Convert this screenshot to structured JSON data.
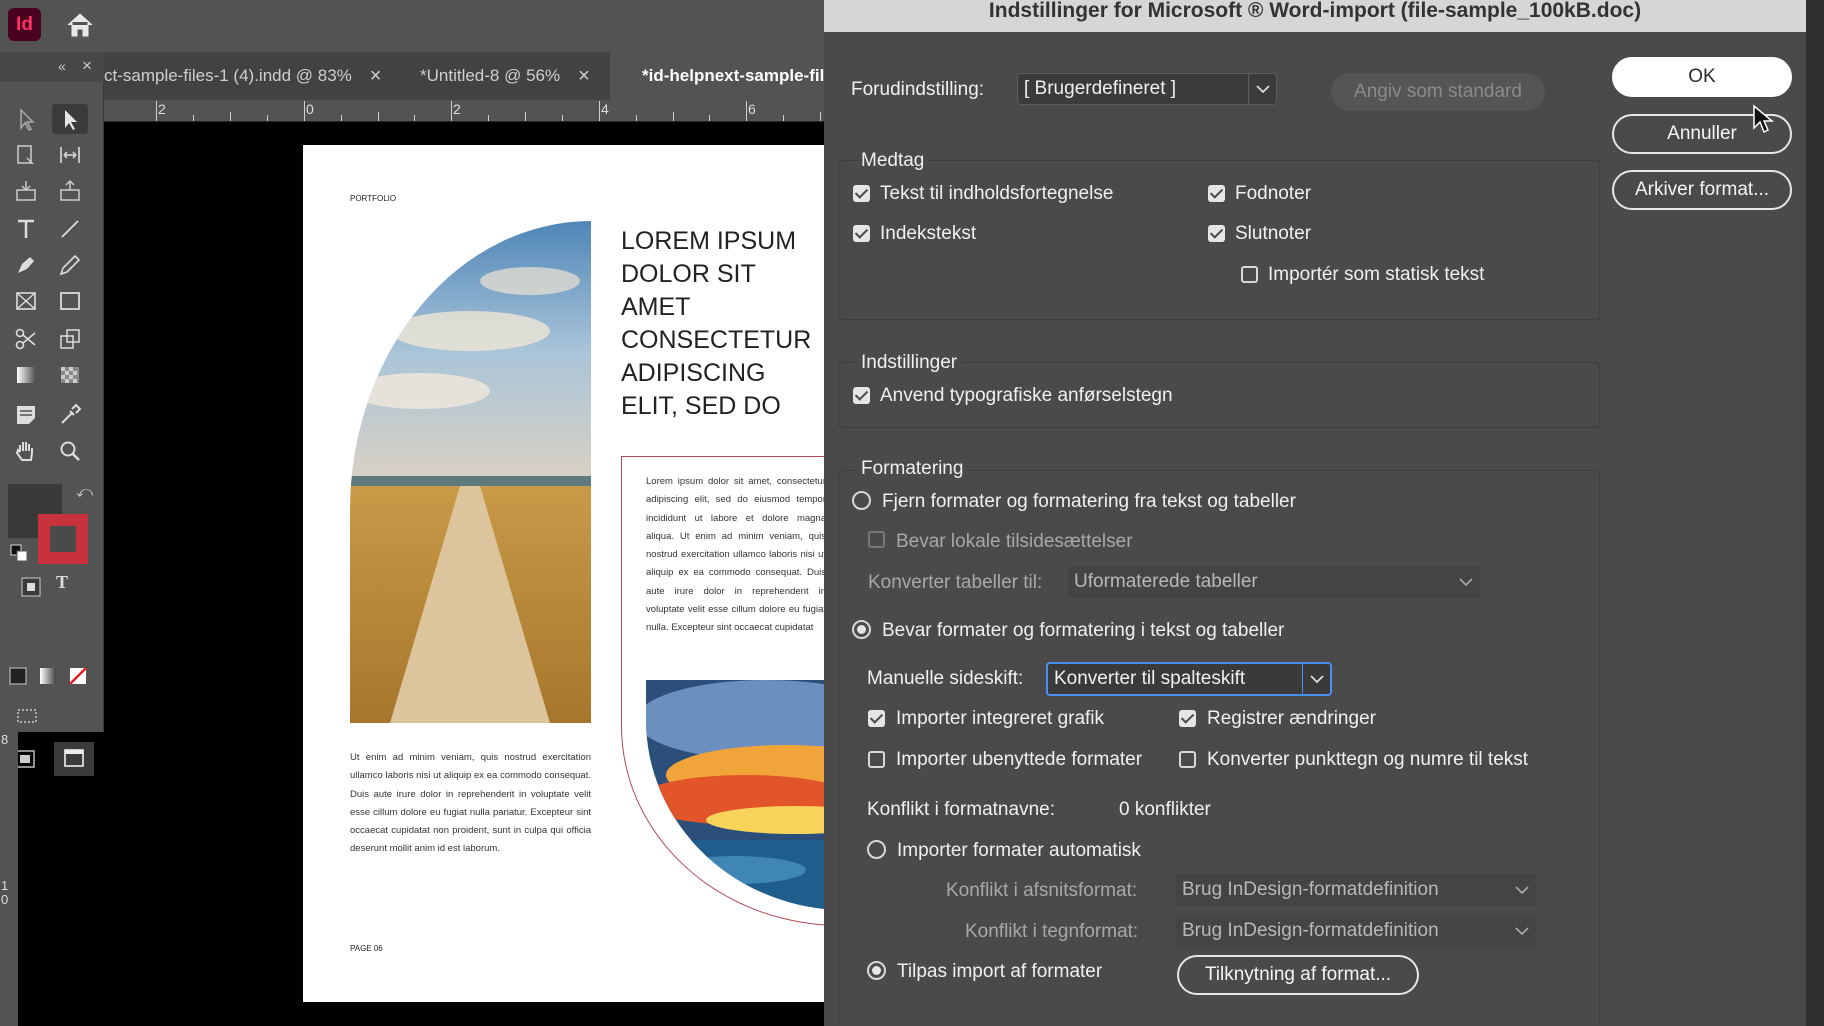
{
  "app": {
    "logo_text": "Id",
    "tabs": [
      {
        "label": "ct-sample-files-1 (4).indd @ 83%",
        "close": "×"
      },
      {
        "label": "*Untitled-8 @ 56%",
        "close": "×"
      },
      {
        "label": "*id-helpnext-sample-file"
      }
    ],
    "ruler_numbers": [
      "2",
      "0",
      "2",
      "4",
      "6"
    ],
    "vruler_numbers": [
      "8",
      "1",
      "0"
    ]
  },
  "document": {
    "portfolio": "PORTFOLIO",
    "headline": "LOREM IPSUM DOLOR SIT AMET CONSECTETUR ADIPISCING ELIT, SED DO",
    "body_right": "Lorem ipsum dolor sit amet, consectetur adipiscing elit, sed do eiusmod tempor incididunt ut labore et dolore magna aliqua. Ut enim ad minim veniam, quis nostrud exercitation ullamco laboris nisi ut aliquip ex ea commodo consequat. Duis aute irure dolor in reprehenderit in voluptate velit esse cillum dolore eu fugiat nulla. Excepteur sint occaecat cupidatat",
    "body_left": "Ut enim ad minim veniam, quis nostrud exercitation ullamco laboris nisi ut aliquip ex ea commodo consequat. Duis aute irure dolor in reprehenderit in voluptate velit esse cillum dolore eu fugiat nulla pariatur. Excepteur sint occaecat cupidatat non proident, sunt in culpa qui officia deserunt mollit anim id est laborum.",
    "page_no": "PAGE 06"
  },
  "dialog": {
    "title": "Indstillinger for Microsoft ® Word-import (file-sample_100kB.doc)",
    "preset_label": "Forudindstilling:",
    "preset_value": "[ Brugerdefineret ]",
    "set_default": "Angiv som standard",
    "ok": "OK",
    "cancel": "Annuller",
    "save_preset": "Arkiver format...",
    "include": {
      "title": "Medtag",
      "toc": "Tekst til indholdsfortegnelse",
      "index": "Indekstekst",
      "footnotes": "Fodnoter",
      "endnotes": "Slutnoter",
      "static": "Importér som statisk tekst"
    },
    "options": {
      "title": "Indstillinger",
      "quotes": "Anvend typografiske anførselstegn"
    },
    "formatting": {
      "title": "Formatering",
      "remove": "Fjern formater og formatering fra tekst og tabeller",
      "keep_local": "Bevar lokale tilsidesættelser",
      "convert_tables_label": "Konverter tabeller til:",
      "convert_tables_value": "Uformaterede tabeller",
      "preserve": "Bevar formater og formatering i tekst og tabeller",
      "manual_breaks_label": "Manuelle sideskift:",
      "manual_breaks_value": "Konverter til spalteskift",
      "inline_graphics": "Importer integreret grafik",
      "track_changes": "Registrer ændringer",
      "unused_styles": "Importer ubenyttede formater",
      "bullets": "Konverter punkttegn og numre til tekst",
      "conflict_label": "Konflikt i formatnavne:",
      "conflict_value": "0 konflikter",
      "auto_import": "Importer formater automatisk",
      "para_conflict_label": "Konflikt i afsnitsformat:",
      "para_conflict_value": "Brug InDesign-formatdefinition",
      "char_conflict_label": "Konflikt i tegnformat:",
      "char_conflict_value": "Brug InDesign-formatdefinition",
      "customize": "Tilpas import af formater",
      "mapping_button": "Tilknytning af format..."
    }
  },
  "colors": {
    "accent_focus": "#4b8ff0",
    "indesign_logo": "#ff3366"
  }
}
